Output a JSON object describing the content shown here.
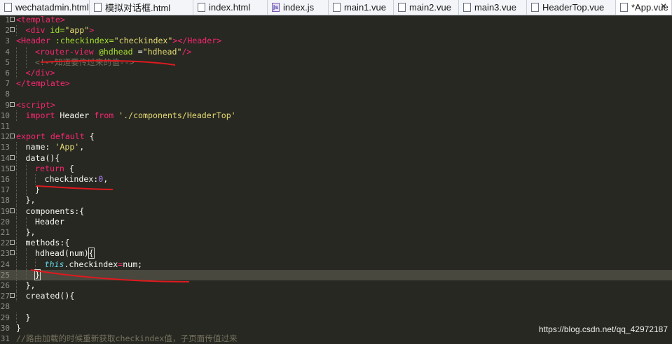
{
  "tabs": [
    {
      "label": "wechatadmin.html",
      "icon": "html-file-icon",
      "active": false
    },
    {
      "label": "模拟对话框.html",
      "icon": "html-file-icon",
      "active": false
    },
    {
      "label": "index.html",
      "icon": "html-file-icon",
      "active": false
    },
    {
      "label": "index.js",
      "icon": "js-file-icon",
      "active": false
    },
    {
      "label": "main1.vue",
      "icon": "vue-file-icon",
      "active": false
    },
    {
      "label": "main2.vue",
      "icon": "vue-file-icon",
      "active": false
    },
    {
      "label": "main3.vue",
      "icon": "vue-file-icon",
      "active": false
    },
    {
      "label": "HeaderTop.vue",
      "icon": "vue-file-icon",
      "active": false
    },
    {
      "label": "*App.vue",
      "icon": "vue-file-icon",
      "active": true,
      "close_glyph": "✕"
    }
  ],
  "current_line": 25,
  "lines": [
    {
      "n": "1",
      "fold": true,
      "indent": 0,
      "tokens": [
        [
          "tag",
          "<template>"
        ]
      ]
    },
    {
      "n": "2",
      "fold": true,
      "indent": 1,
      "tokens": [
        [
          "tag",
          "<div"
        ],
        [
          "plain",
          " "
        ],
        [
          "attr",
          "id="
        ],
        [
          "str",
          "\"app\""
        ],
        [
          "tag",
          ">"
        ]
      ]
    },
    {
      "n": "3",
      "fold": false,
      "indent": 0,
      "tokens": [
        [
          "tag",
          "<Header"
        ],
        [
          "plain",
          " "
        ],
        [
          "attr",
          ":checkindex="
        ],
        [
          "str",
          "\"checkindex\""
        ],
        [
          "tag",
          "></Header>"
        ]
      ]
    },
    {
      "n": "4",
      "fold": false,
      "indent": 2,
      "tokens": [
        [
          "tag",
          "<router-view"
        ],
        [
          "plain",
          " "
        ],
        [
          "attr",
          "@hdhead"
        ],
        [
          "plain",
          " ="
        ],
        [
          "str",
          "\"hdhead\""
        ],
        [
          "tag",
          "/>"
        ]
      ]
    },
    {
      "n": "5",
      "fold": false,
      "indent": 2,
      "tokens": [
        [
          "com",
          "<!--知道要传过来的值-->"
        ]
      ]
    },
    {
      "n": "6",
      "fold": false,
      "indent": 1,
      "tokens": [
        [
          "tag",
          "</div>"
        ]
      ]
    },
    {
      "n": "7",
      "fold": false,
      "indent": 0,
      "tokens": [
        [
          "tag",
          "</template>"
        ]
      ]
    },
    {
      "n": "8",
      "fold": false,
      "indent": 0,
      "tokens": []
    },
    {
      "n": "9",
      "fold": true,
      "indent": 0,
      "tokens": [
        [
          "tag",
          "<script>"
        ]
      ]
    },
    {
      "n": "10",
      "fold": false,
      "indent": 1,
      "tokens": [
        [
          "kw",
          "import"
        ],
        [
          "plain",
          " Header "
        ],
        [
          "kw",
          "from"
        ],
        [
          "plain",
          " "
        ],
        [
          "str",
          "'./components/HeaderTop'"
        ]
      ]
    },
    {
      "n": "11",
      "fold": false,
      "indent": 0,
      "tokens": []
    },
    {
      "n": "12",
      "fold": true,
      "indent": 0,
      "tokens": [
        [
          "kw",
          "export"
        ],
        [
          "plain",
          " "
        ],
        [
          "kw",
          "default"
        ],
        [
          "plain",
          " {"
        ]
      ]
    },
    {
      "n": "13",
      "fold": false,
      "indent": 1,
      "tokens": [
        [
          "plain",
          "name: "
        ],
        [
          "str",
          "'App'"
        ],
        [
          "plain",
          ","
        ]
      ]
    },
    {
      "n": "14",
      "fold": true,
      "indent": 1,
      "tokens": [
        [
          "plain",
          "data(){"
        ]
      ]
    },
    {
      "n": "15",
      "fold": true,
      "indent": 2,
      "tokens": [
        [
          "kw",
          "return"
        ],
        [
          "plain",
          " {"
        ]
      ]
    },
    {
      "n": "16",
      "fold": false,
      "indent": 3,
      "tokens": [
        [
          "plain",
          "checkindex:"
        ],
        [
          "num",
          "0"
        ],
        [
          "plain",
          ","
        ]
      ]
    },
    {
      "n": "17",
      "fold": false,
      "indent": 2,
      "tokens": [
        [
          "plain",
          "}"
        ]
      ]
    },
    {
      "n": "18",
      "fold": false,
      "indent": 1,
      "tokens": [
        [
          "plain",
          "},"
        ]
      ]
    },
    {
      "n": "19",
      "fold": true,
      "indent": 1,
      "tokens": [
        [
          "plain",
          "components:{"
        ]
      ]
    },
    {
      "n": "20",
      "fold": false,
      "indent": 2,
      "tokens": [
        [
          "plain",
          "Header"
        ]
      ]
    },
    {
      "n": "21",
      "fold": false,
      "indent": 1,
      "tokens": [
        [
          "plain",
          "},"
        ]
      ]
    },
    {
      "n": "22",
      "fold": true,
      "indent": 1,
      "tokens": [
        [
          "plain",
          "methods:{"
        ]
      ]
    },
    {
      "n": "23",
      "fold": true,
      "indent": 2,
      "tokens": [
        [
          "plain",
          "hdhead(num)"
        ],
        [
          "bracket",
          "{"
        ]
      ]
    },
    {
      "n": "24",
      "fold": false,
      "indent": 3,
      "tokens": [
        [
          "this",
          "this"
        ],
        [
          "plain",
          ".checkindex"
        ],
        [
          "kw",
          "="
        ],
        [
          "plain",
          "num;"
        ]
      ]
    },
    {
      "n": "25",
      "fold": false,
      "indent": 2,
      "tokens": [
        [
          "bracket",
          "}"
        ],
        [
          "caret",
          ""
        ]
      ]
    },
    {
      "n": "26",
      "fold": false,
      "indent": 1,
      "tokens": [
        [
          "plain",
          "},"
        ]
      ]
    },
    {
      "n": "27",
      "fold": true,
      "indent": 1,
      "tokens": [
        [
          "plain",
          "created(){"
        ]
      ]
    },
    {
      "n": "28",
      "fold": false,
      "indent": 0,
      "tokens": []
    },
    {
      "n": "29",
      "fold": false,
      "indent": 1,
      "tokens": [
        [
          "plain",
          "}"
        ]
      ]
    },
    {
      "n": "30",
      "fold": false,
      "indent": 0,
      "tokens": [
        [
          "plain",
          "}"
        ]
      ]
    },
    {
      "n": "31",
      "fold": false,
      "indent": 0,
      "tokens": [
        [
          "com",
          "//路由加载的时候重新获取checkindex值，子页面传值过来"
        ]
      ]
    }
  ],
  "watermark": "https://blog.csdn.net/qq_42972187",
  "colors": {
    "background": "#272822",
    "tag": "#f92672",
    "attr": "#a6e22e",
    "string": "#e6db74",
    "number": "#ae81ff",
    "comment": "#75715e",
    "annotation": "#e0191e"
  }
}
